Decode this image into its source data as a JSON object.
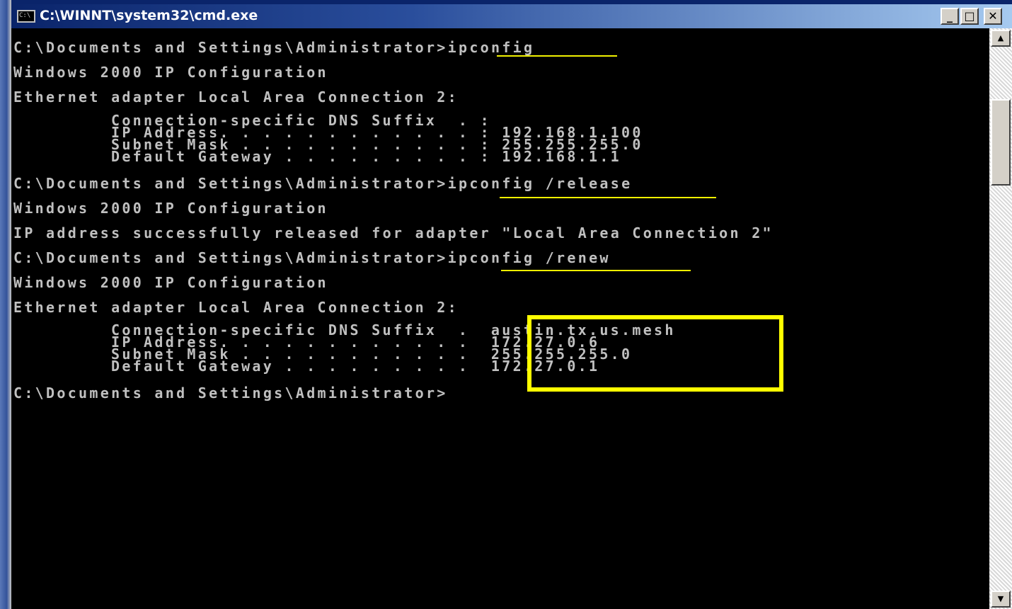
{
  "window": {
    "title": "C:\\WINNT\\system32\\cmd.exe",
    "icon_text": "C:\\",
    "buttons": {
      "minimize": "_",
      "maximize": "□",
      "close": "✕"
    }
  },
  "console": {
    "lines": [
      "C:\\Documents and Settings\\Administrator>ipconfig",
      "Windows 2000 IP Configuration",
      "Ethernet adapter Local Area Connection 2:",
      "C:\\Documents and Settings\\Administrator>ipconfig /release",
      "Windows 2000 IP Configuration",
      "IP address successfully released for adapter \"Local Area Connection 2\"",
      "C:\\Documents and Settings\\Administrator>ipconfig /renew",
      "Windows 2000 IP Configuration",
      "Ethernet adapter Local Area Connection 2:",
      "C:\\Documents and Settings\\Administrator>"
    ],
    "first_config": [
      "Connection-specific DNS Suffix  . :",
      "IP Address. . . . . . . . . . . . : 192.168.1.100",
      "Subnet Mask . . . . . . . . . . . : 255.255.255.0",
      "Default Gateway . . . . . . . . . : 192.168.1.1"
    ],
    "renew_config": [
      "Connection-specific DNS Suffix  .  austin.tx.us.mesh",
      "IP Address. . . . . . . . . . . .  172.27.0.6",
      "Subnet Mask . . . . . . . . . . .  255.255.255.0",
      "Default Gateway . . . . . . . . .  172.27.0.1"
    ]
  },
  "colors": {
    "console_bg": "#000000",
    "console_text": "#c0c0c0",
    "highlight": "#ffff00",
    "titlebar": "#0a246a"
  },
  "icons": {
    "up": "▲",
    "down": "▼"
  }
}
